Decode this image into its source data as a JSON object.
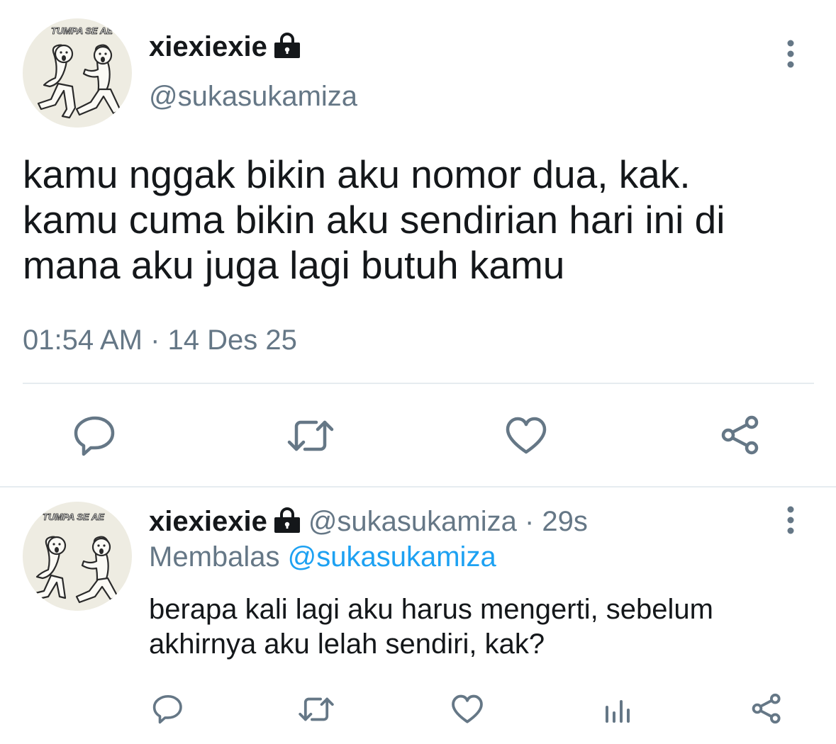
{
  "main_tweet": {
    "display_name": "xiexiexie",
    "handle": "@sukasukamiza",
    "avatar_text": "TUMPA SE AE",
    "text": "kamu nggak bikin aku nomor dua, kak. kamu cuma bikin aku sendirian hari ini di mana aku juga lagi butuh kamu",
    "timestamp": "01:54 AM · 14 Des 25",
    "actions": [
      "reply-icon",
      "retweet-icon",
      "like-icon",
      "share-icon"
    ]
  },
  "reply_tweet": {
    "display_name": "xiexiexie",
    "handle": "@sukasukamiza",
    "time_separator": " · ",
    "age": "29s",
    "replying_label": "Membalas",
    "replying_to": "@sukasukamiza",
    "avatar_text": "TUMPA SE AE",
    "text": "berapa kali lagi aku harus mengerti, sebelum akhirnya aku lelah sendiri, kak?",
    "actions": [
      "reply-icon",
      "retweet-icon",
      "like-icon",
      "analytics-icon",
      "share-icon"
    ]
  },
  "colors": {
    "text": "#14171a",
    "secondary": "#657786",
    "link": "#1da1f2",
    "divider": "#e6ecf0"
  }
}
